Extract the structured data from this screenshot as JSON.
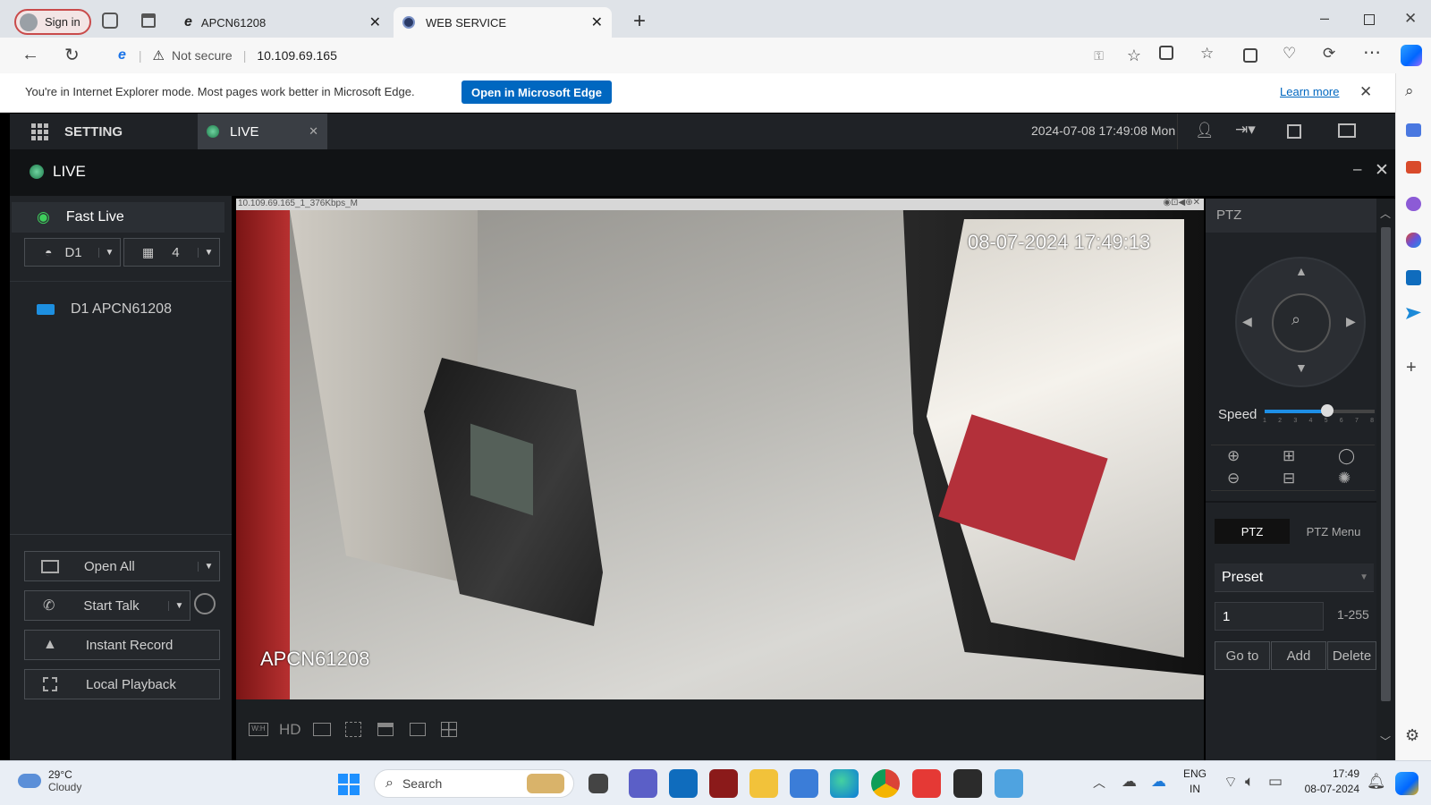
{
  "browser": {
    "sign_in": "Sign in",
    "tabs": [
      {
        "title": "APCN61208",
        "active": false
      },
      {
        "title": "WEB SERVICE",
        "active": true
      }
    ],
    "security": "Not secure",
    "url": "10.109.69.165",
    "infobar_text": "You're in Internet Explorer mode. Most pages work better in Microsoft Edge.",
    "open_edge_button": "Open in Microsoft Edge",
    "learn_more": "Learn more"
  },
  "app": {
    "setting_label": "SETTING",
    "live_tab_label": "LIVE",
    "datetime": "2024-07-08 17:49:08 Mon",
    "live_title": "LIVE"
  },
  "left_panel": {
    "fast_live": "Fast Live",
    "device_select": "D1",
    "split_select": "4",
    "device_item": "D1 APCN61208",
    "buttons": {
      "open_all": "Open All",
      "start_talk": "Start Talk",
      "instant_record": "Instant Record",
      "local_playback": "Local Playback"
    }
  },
  "video": {
    "stream_info": "10.109.69.165_1_376Kbps_M",
    "osd_timestamp": "08-07-2024 17:49:13",
    "osd_name": "APCN61208",
    "toolbar_hd": "HD"
  },
  "ptz": {
    "title": "PTZ",
    "speed_label": "Speed",
    "speed_ticks": [
      "1",
      "2",
      "3",
      "4",
      "5",
      "6",
      "7",
      "8"
    ],
    "speed_value": 5,
    "tab_ptz": "PTZ",
    "tab_menu": "PTZ Menu",
    "preset_label": "Preset",
    "preset_value": "1",
    "preset_range": "1-255",
    "goto": "Go to",
    "add": "Add",
    "delete": "Delete"
  },
  "taskbar": {
    "weather_temp": "29°C",
    "weather_desc": "Cloudy",
    "search_placeholder": "Search",
    "lang_1": "ENG",
    "lang_2": "IN",
    "time": "17:49",
    "date": "08-07-2024"
  },
  "colors": {
    "edge_blue": "#0067c0",
    "app_dark": "#1f2226",
    "live_dot": "#2e8b57",
    "osd_text": "#ffffff"
  }
}
